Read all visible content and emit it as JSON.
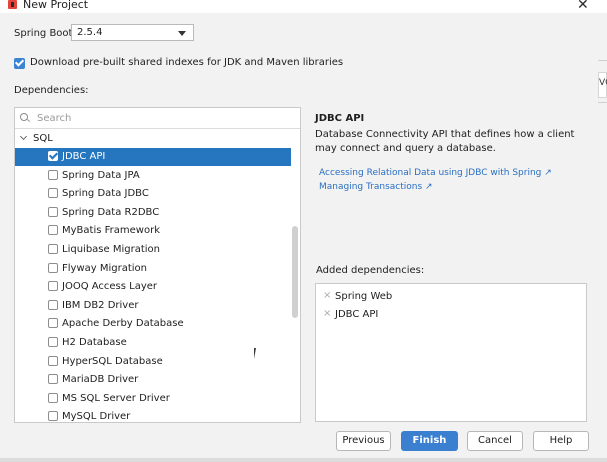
{
  "window": {
    "title": "New Project",
    "close_glyph": "✕"
  },
  "spring_boot": {
    "label": "Spring Boot:",
    "selected": "2.5.4"
  },
  "download_indexes": {
    "label": "Download pre-built shared indexes for JDK and Maven libraries",
    "checked": true
  },
  "dependencies": {
    "label": "Dependencies:",
    "search_placeholder": "Search",
    "group": "SQL",
    "items": [
      {
        "label": "JDBC API",
        "checked": true,
        "selected": true
      },
      {
        "label": "Spring Data JPA",
        "checked": false
      },
      {
        "label": "Spring Data JDBC",
        "checked": false
      },
      {
        "label": "Spring Data R2DBC",
        "checked": false
      },
      {
        "label": "MyBatis Framework",
        "checked": false
      },
      {
        "label": "Liquibase Migration",
        "checked": false
      },
      {
        "label": "Flyway Migration",
        "checked": false
      },
      {
        "label": "JOOQ Access Layer",
        "checked": false
      },
      {
        "label": "IBM DB2 Driver",
        "checked": false
      },
      {
        "label": "Apache Derby Database",
        "checked": false
      },
      {
        "label": "H2 Database",
        "checked": false
      },
      {
        "label": "HyperSQL Database",
        "checked": false
      },
      {
        "label": "MariaDB Driver",
        "checked": false
      },
      {
        "label": "MS SQL Server Driver",
        "checked": false
      },
      {
        "label": "MySQL Driver",
        "checked": false
      }
    ]
  },
  "detail": {
    "title": "JDBC API",
    "description": "Database Connectivity API that defines how a client may connect and query a database.",
    "links": [
      "Accessing Relational Data using JDBC with Spring ↗",
      "Managing Transactions ↗"
    ]
  },
  "added": {
    "label": "Added dependencies:",
    "remove_glyph": "×",
    "items": [
      "Spring Web",
      "JDBC API"
    ]
  },
  "buttons": {
    "previous": "Previous",
    "finish": "Finish",
    "cancel": "Cancel",
    "help": "Help"
  },
  "background": {
    "fragment_text": "VC"
  },
  "colors": {
    "accent": "#2675bf",
    "primary_button": "#3a7fd0",
    "link": "#2a6fc2"
  }
}
